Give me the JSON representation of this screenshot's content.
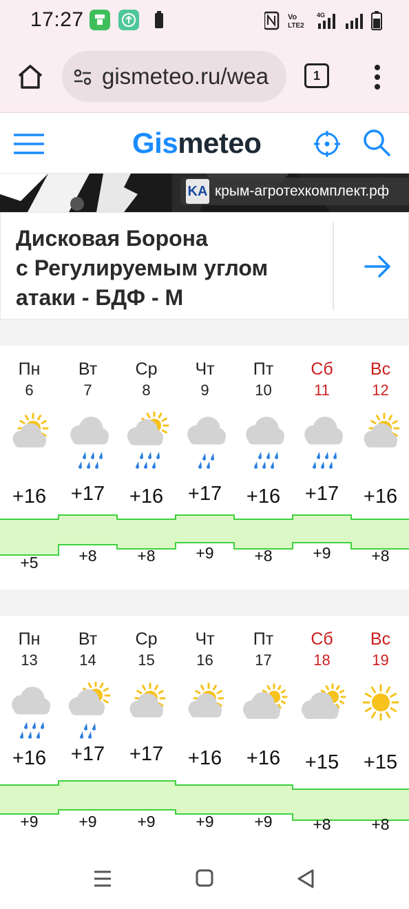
{
  "status_bar": {
    "time": "17:27"
  },
  "browser": {
    "url": "gismeteo.ru/wea",
    "tab_count": "1"
  },
  "site": {
    "logo_part1": "Gis",
    "logo_part2": "meteo",
    "brand_color": "#1a8cff"
  },
  "ad": {
    "domain": "крым-агротехкомплект.рф",
    "logo_text": "KA",
    "title_line1": "Дисковая Борона",
    "title_line2": "с Регулируемым углом",
    "title_line3": "атаки - БДФ - М"
  },
  "weeks": [
    {
      "days": [
        {
          "name": "Пн",
          "num": "6",
          "weekend": false,
          "icon": "partly-cloudy-icon",
          "tmax": "+16",
          "tmin": "+5"
        },
        {
          "name": "Вт",
          "num": "7",
          "weekend": false,
          "icon": "cloud-rain-icon",
          "tmax": "+17",
          "tmin": "+8"
        },
        {
          "name": "Ср",
          "num": "8",
          "weekend": false,
          "icon": "sun-cloud-rain-icon",
          "tmax": "+16",
          "tmin": "+8"
        },
        {
          "name": "Чт",
          "num": "9",
          "weekend": false,
          "icon": "cloud-light-rain-icon",
          "tmax": "+17",
          "tmin": "+9"
        },
        {
          "name": "Пт",
          "num": "10",
          "weekend": false,
          "icon": "cloud-rain-icon",
          "tmax": "+16",
          "tmin": "+8"
        },
        {
          "name": "Сб",
          "num": "11",
          "weekend": true,
          "icon": "cloud-rain-icon",
          "tmax": "+17",
          "tmin": "+9"
        },
        {
          "name": "Вс",
          "num": "12",
          "weekend": true,
          "icon": "partly-cloudy-icon",
          "tmax": "+16",
          "tmin": "+8"
        }
      ]
    },
    {
      "days": [
        {
          "name": "Пн",
          "num": "13",
          "weekend": false,
          "icon": "cloud-rain-icon",
          "tmax": "+16",
          "tmin": "+9"
        },
        {
          "name": "Вт",
          "num": "14",
          "weekend": false,
          "icon": "sun-cloud-light-rain-icon",
          "tmax": "+17",
          "tmin": "+9"
        },
        {
          "name": "Ср",
          "num": "15",
          "weekend": false,
          "icon": "partly-cloudy-icon",
          "tmax": "+17",
          "tmin": "+9"
        },
        {
          "name": "Чт",
          "num": "16",
          "weekend": false,
          "icon": "partly-cloudy-icon",
          "tmax": "+16",
          "tmin": "+9"
        },
        {
          "name": "Пт",
          "num": "17",
          "weekend": false,
          "icon": "cloudy-sun-icon",
          "tmax": "+16",
          "tmin": "+9"
        },
        {
          "name": "Сб",
          "num": "18",
          "weekend": true,
          "icon": "cloudy-sun-icon",
          "tmax": "+15",
          "tmin": "+8"
        },
        {
          "name": "Вс",
          "num": "19",
          "weekend": true,
          "icon": "sun-icon",
          "tmax": "+15",
          "tmin": "+8"
        }
      ]
    }
  ],
  "colors": {
    "weekend": "#cc1f1f",
    "band_fill": "#dcf8c6",
    "band_line": "#3fd13f"
  }
}
